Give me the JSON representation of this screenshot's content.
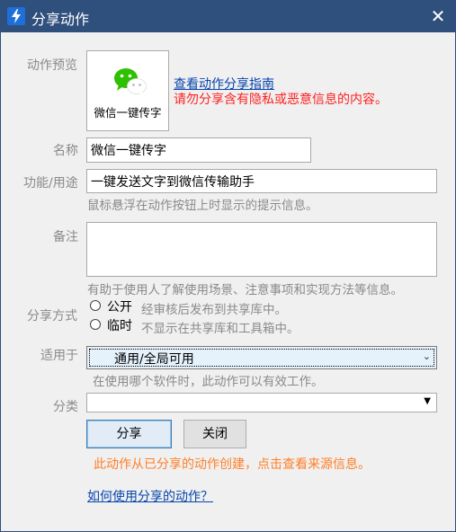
{
  "window": {
    "title": "分享动作",
    "close_glyph": "✕"
  },
  "preview": {
    "label": "动作预览",
    "action_name": "微信一键传字",
    "icon": "wechat-icon",
    "view_guide_link": "查看动作分享指南",
    "privacy_warning": "请勿分享含有隐私或恶意信息的内容。"
  },
  "fields": {
    "name_label": "名称",
    "name_value": "微信一键传字",
    "function_label": "功能/用途",
    "function_value": "一键发送文字到微信传输助手",
    "function_hint": "鼠标悬浮在动作按钮上时显示的提示信息。",
    "notes_label": "备注",
    "notes_value": "",
    "notes_hint": "有助于使用人了解使用场景、注意事项和实现方法等信息。"
  },
  "share_mode": {
    "label": "分享方式",
    "options": [
      {
        "label": "公开",
        "hint": "经审核后发布到共享库中。",
        "selected": false
      },
      {
        "label": "临时",
        "hint": "不显示在共享库和工具箱中。",
        "selected": false
      }
    ]
  },
  "applies_to": {
    "label": "适用于",
    "value": "通用/全局可用",
    "hint": "在使用哪个软件时，此动作可以有效工作。"
  },
  "category": {
    "label": "分类",
    "value": ""
  },
  "buttons": {
    "share": "分享",
    "close": "关闭"
  },
  "source_note": "此动作从已分享的动作创建，点击查看来源信息。",
  "help_link": "如何使用分享的动作？",
  "colors": {
    "title_bar": "#2f4f7c",
    "link": "#0645ad",
    "warning_red": "#ff1f1f",
    "note_orange": "#ff7f27",
    "wechat_green": "#2dc100"
  }
}
